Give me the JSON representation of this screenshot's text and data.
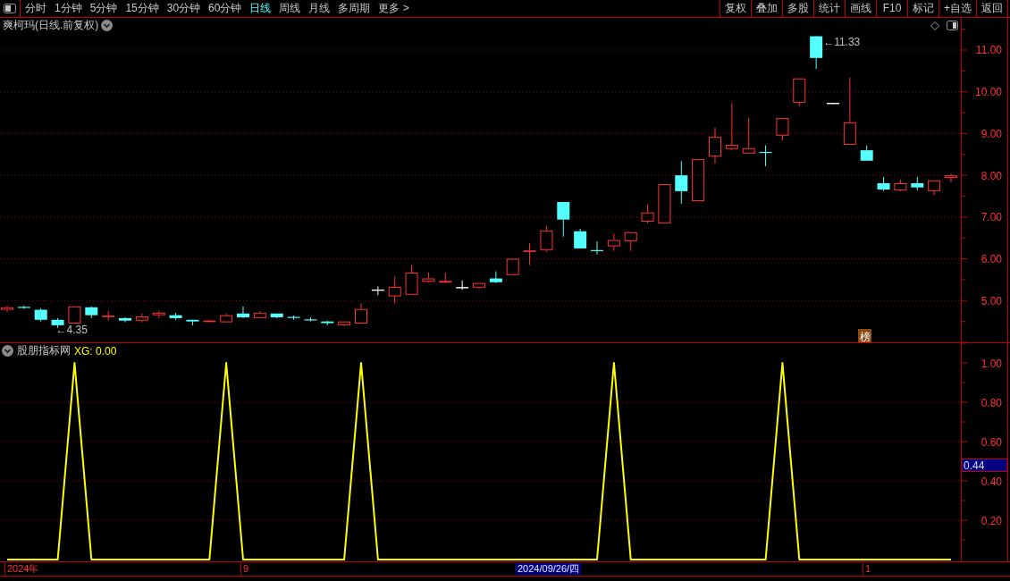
{
  "toolbar": {
    "tabs": [
      {
        "label": "分时",
        "selected": false
      },
      {
        "label": "1分钟",
        "selected": false
      },
      {
        "label": "5分钟",
        "selected": false
      },
      {
        "label": "15分钟",
        "selected": false
      },
      {
        "label": "30分钟",
        "selected": false
      },
      {
        "label": "60分钟",
        "selected": false
      },
      {
        "label": "日线",
        "selected": true
      },
      {
        "label": "周线",
        "selected": false
      },
      {
        "label": "月线",
        "selected": false
      },
      {
        "label": "多周期",
        "selected": false
      },
      {
        "label": "更多 >",
        "selected": false
      }
    ],
    "buttons": [
      "复权",
      "叠加",
      "多股",
      "统计",
      "画线",
      "F10",
      "标记",
      "+自选",
      "返回"
    ]
  },
  "chart": {
    "badge": "榜",
    "chart_data": {
      "type": "candlestick",
      "title": "爽柯玛(日线.前复权)",
      "ohlc": [
        [
          4.78,
          4.87,
          4.73,
          4.84
        ],
        [
          4.85,
          4.88,
          4.8,
          4.84
        ],
        [
          4.78,
          4.82,
          4.5,
          4.54
        ],
        [
          4.54,
          4.58,
          4.35,
          4.41
        ],
        [
          4.45,
          4.86,
          4.45,
          4.86
        ],
        [
          4.84,
          4.86,
          4.58,
          4.65
        ],
        [
          4.62,
          4.75,
          4.52,
          4.64
        ],
        [
          4.58,
          4.6,
          4.48,
          4.52
        ],
        [
          4.52,
          4.69,
          4.48,
          4.62
        ],
        [
          4.65,
          4.75,
          4.58,
          4.71
        ],
        [
          4.65,
          4.71,
          4.54,
          4.58
        ],
        [
          4.54,
          4.54,
          4.41,
          4.5
        ],
        [
          4.5,
          4.54,
          4.5,
          4.52
        ],
        [
          4.48,
          4.69,
          4.48,
          4.65
        ],
        [
          4.69,
          4.86,
          4.58,
          4.6
        ],
        [
          4.58,
          4.75,
          4.58,
          4.71
        ],
        [
          4.69,
          4.69,
          4.58,
          4.6
        ],
        [
          4.61,
          4.64,
          4.54,
          4.6
        ],
        [
          4.55,
          4.6,
          4.5,
          4.54
        ],
        [
          4.5,
          4.52,
          4.41,
          4.46
        ],
        [
          4.41,
          4.5,
          4.39,
          4.5
        ],
        [
          4.45,
          4.93,
          4.45,
          4.8
        ],
        [
          5.25,
          5.33,
          5.14,
          5.25
        ],
        [
          5.1,
          5.57,
          4.93,
          5.33
        ],
        [
          5.14,
          5.85,
          5.14,
          5.67
        ],
        [
          5.45,
          5.67,
          5.43,
          5.53
        ],
        [
          5.43,
          5.67,
          5.43,
          5.47
        ],
        [
          5.31,
          5.47,
          5.27,
          5.31
        ],
        [
          5.31,
          5.42,
          5.29,
          5.42
        ],
        [
          5.53,
          5.7,
          5.42,
          5.44
        ],
        [
          5.61,
          6.0,
          5.61,
          6.0
        ],
        [
          6.18,
          6.38,
          5.85,
          6.2
        ],
        [
          6.21,
          6.79,
          6.17,
          6.68
        ],
        [
          7.36,
          7.36,
          6.53,
          6.94
        ],
        [
          6.66,
          6.72,
          6.25,
          6.25
        ],
        [
          6.21,
          6.42,
          6.1,
          6.19
        ],
        [
          6.3,
          6.6,
          6.19,
          6.45
        ],
        [
          6.42,
          6.64,
          6.19,
          6.64
        ],
        [
          6.89,
          7.3,
          6.85,
          7.11
        ],
        [
          6.85,
          7.79,
          6.85,
          7.79
        ],
        [
          8.0,
          8.34,
          7.32,
          7.62
        ],
        [
          7.38,
          8.39,
          7.38,
          8.39
        ],
        [
          8.45,
          9.14,
          8.28,
          8.92
        ],
        [
          8.63,
          9.73,
          8.6,
          8.73
        ],
        [
          8.52,
          9.37,
          8.52,
          8.65
        ],
        [
          8.56,
          8.72,
          8.22,
          8.54
        ],
        [
          8.95,
          9.37,
          8.84,
          9.37
        ],
        [
          9.74,
          10.32,
          9.65,
          10.32
        ],
        [
          11.33,
          11.33,
          10.55,
          10.81
        ],
        [
          9.72,
          9.72,
          9.72,
          9.72
        ],
        [
          8.73,
          10.34,
          8.73,
          9.27
        ],
        [
          8.6,
          8.71,
          8.35,
          8.35
        ],
        [
          7.81,
          7.96,
          7.62,
          7.66
        ],
        [
          7.64,
          7.9,
          7.62,
          7.81
        ],
        [
          7.81,
          7.96,
          7.64,
          7.71
        ],
        [
          7.62,
          7.88,
          7.53,
          7.88
        ],
        [
          7.94,
          8.03,
          7.83,
          8.0
        ]
      ],
      "ylim": [
        4,
        11.77
      ],
      "yticks": [
        {
          "value": 11,
          "label": "11.00"
        },
        {
          "value": 10,
          "label": "10.00"
        },
        {
          "value": 9,
          "label": "9.00"
        },
        {
          "value": 8,
          "label": "8.00"
        },
        {
          "value": 7,
          "label": "7.00"
        },
        {
          "value": 6,
          "label": "6.00"
        },
        {
          "value": 5,
          "label": "5.00"
        }
      ],
      "grid": true,
      "annotations": [
        "←11.33",
        "←4.35"
      ]
    }
  },
  "indicator": {
    "readout": "XG: 0.00",
    "cursor_value": "0.44",
    "chart_data": {
      "type": "line",
      "title": "股朋指标网",
      "values": [
        0,
        0,
        0,
        0,
        1,
        0,
        0,
        0,
        0,
        0,
        0,
        0,
        0,
        1,
        0,
        0,
        0,
        0,
        0,
        0,
        0,
        1,
        0,
        0,
        0,
        0,
        0,
        0,
        0,
        0,
        0,
        0,
        0,
        0,
        0,
        0,
        1,
        0,
        0,
        0,
        0,
        0,
        0,
        0,
        0,
        0,
        1,
        0,
        0,
        0,
        0,
        0,
        0,
        0,
        0,
        0,
        0
      ],
      "ylim": [
        0,
        1.1
      ],
      "yticks": [
        {
          "value": 0.2,
          "label": "0.20"
        },
        {
          "value": 0.4,
          "label": "0.40"
        },
        {
          "value": 0.6,
          "label": "0.60"
        },
        {
          "value": 0.8,
          "label": "0.80"
        },
        {
          "value": 1,
          "label": "1.00"
        }
      ],
      "grid": true
    }
  },
  "date_axis": [
    {
      "label": "2024年",
      "kind": "tick"
    },
    {
      "label": "9",
      "kind": "tick"
    },
    {
      "label": "2024/09/26/四",
      "kind": "cursor"
    },
    {
      "label": "1",
      "kind": "tick"
    }
  ]
}
